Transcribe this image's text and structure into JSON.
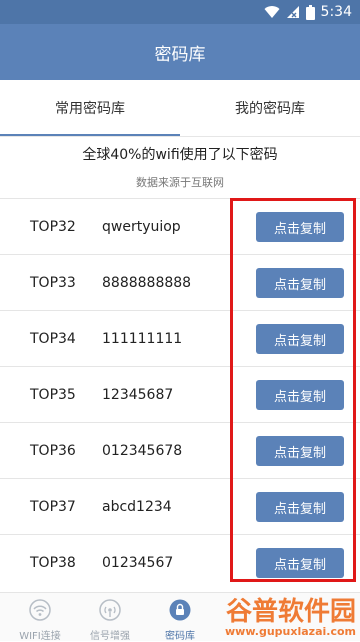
{
  "status_bar": {
    "time": "5:34"
  },
  "app_bar": {
    "title": "密码库"
  },
  "tabs": [
    {
      "label": "常用密码库",
      "selected": true
    },
    {
      "label": "我的密码库",
      "selected": false
    }
  ],
  "headline": "全球40%的wifi使用了以下密码",
  "subline": "数据来源于互联网",
  "list": [
    {
      "rank": "TOP32",
      "password": "qwertyuiop",
      "button": "点击复制"
    },
    {
      "rank": "TOP33",
      "password": "8888888888",
      "button": "点击复制"
    },
    {
      "rank": "TOP34",
      "password": "111111111",
      "button": "点击复制"
    },
    {
      "rank": "TOP35",
      "password": "12345687",
      "button": "点击复制"
    },
    {
      "rank": "TOP36",
      "password": "012345678",
      "button": "点击复制"
    },
    {
      "rank": "TOP37",
      "password": "abcd1234",
      "button": "点击复制"
    },
    {
      "rank": "TOP38",
      "password": "01234567",
      "button": "点击复制"
    }
  ],
  "bottom_nav": [
    {
      "label": "WIFI连接",
      "icon": "wifi-icon",
      "active": false
    },
    {
      "label": "信号增强",
      "icon": "signal-boost-icon",
      "active": false
    },
    {
      "label": "密码库",
      "icon": "lock-icon",
      "active": true
    }
  ],
  "watermark": {
    "line1": "谷普软件园",
    "line2": "www.gupuxlazai.com"
  },
  "colors": {
    "primary": "#5b82b8",
    "status_bar": "#4e75a8",
    "highlight": "#e01818",
    "watermark": "#ee6a1a"
  }
}
